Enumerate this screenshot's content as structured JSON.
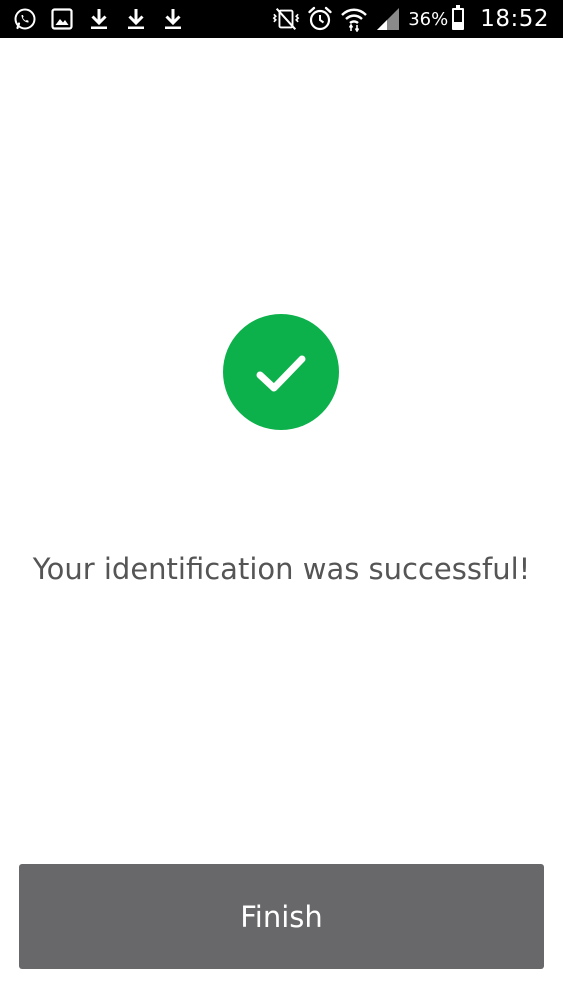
{
  "status_bar": {
    "left_icons": [
      "whatsapp-icon",
      "gallery-icon",
      "download-icon",
      "download-icon",
      "download-icon"
    ],
    "right_icons": [
      "mute-vibrate-icon",
      "alarm-icon",
      "wifi-icon",
      "signal-icon"
    ],
    "battery_percent": "36%",
    "battery_level": 0.36,
    "time": "18:52"
  },
  "success": {
    "icon": "checkmark-icon",
    "color": "#0db14b"
  },
  "message": "Your identification was successful!",
  "finish_button": {
    "label": "Finish",
    "color": "#686769"
  }
}
